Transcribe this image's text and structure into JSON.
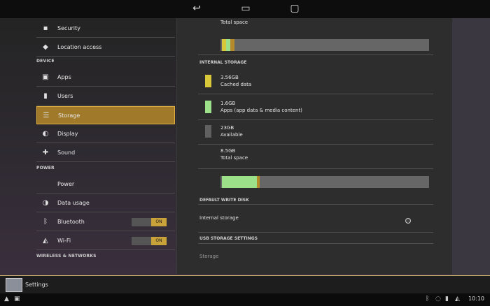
{
  "nav": {
    "back_icon": "back-icon",
    "home_icon": "home-icon",
    "recent_icon": "recent-apps-icon"
  },
  "sidebar": {
    "top_items": [
      {
        "label": "Security",
        "icon": "lock-icon"
      },
      {
        "label": "Location access",
        "icon": "location-icon"
      }
    ],
    "device_header": "DEVICE",
    "device_items": [
      {
        "label": "Apps",
        "icon": "apps-icon"
      },
      {
        "label": "Users",
        "icon": "user-icon"
      },
      {
        "label": "Storage",
        "icon": "storage-icon",
        "selected": true
      },
      {
        "label": "Display",
        "icon": "display-icon"
      },
      {
        "label": "Sound",
        "icon": "sound-icon"
      }
    ],
    "power_header": "POWER",
    "power_items": [
      {
        "label": "Power",
        "icon": ""
      },
      {
        "label": "Data usage",
        "icon": "data-usage-icon"
      },
      {
        "label": "Bluetooth",
        "icon": "bluetooth-icon",
        "toggle": "ON"
      },
      {
        "label": "Wi-Fi",
        "icon": "wifi-icon",
        "toggle": "ON"
      }
    ],
    "bottom_header": "WIRELESS & NETWORKS"
  },
  "panel": {
    "top_label": "Total space",
    "internal_header": "INTERNAL STORAGE",
    "rows": [
      {
        "size": "3.56GB",
        "label": "Cached data",
        "color": "#d8c83a"
      },
      {
        "size": "1.6GB",
        "label": "Apps (app data & media content)",
        "color": "#9de08a"
      },
      {
        "size": "23GB",
        "label": "Available",
        "color": "#606060"
      },
      {
        "size": "8.5GB",
        "label": "Total space",
        "color": ""
      }
    ],
    "default_header": "DEFAULT WRITE DISK",
    "default_option": "Internal storage",
    "usb_header": "USB STORAGE SETTINGS",
    "usb_item": "Storage"
  },
  "taskbar": {
    "app_name": "Settings"
  },
  "sysbar": {
    "clock": "10:10"
  }
}
